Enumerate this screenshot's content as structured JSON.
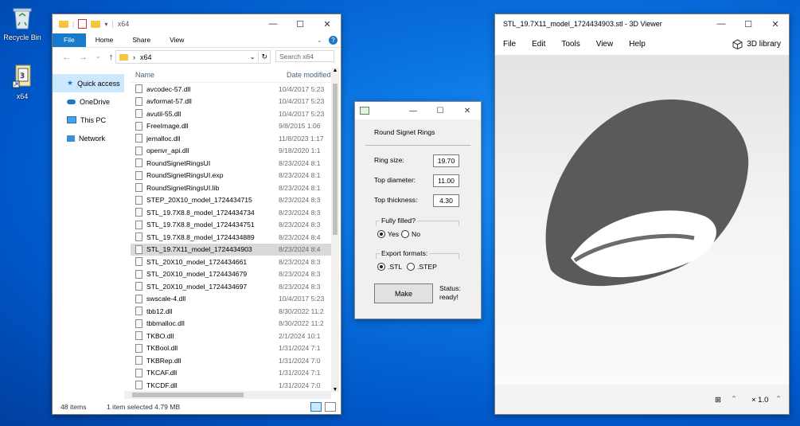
{
  "desktop": {
    "icons": [
      {
        "label": "Recycle Bin"
      },
      {
        "label": "x64"
      }
    ]
  },
  "explorer": {
    "title": "x64",
    "ribbon_tabs": [
      "File",
      "Home",
      "Share",
      "View"
    ],
    "address": {
      "path": "x64"
    },
    "search_placeholder": "Search x64",
    "nav_items": [
      "Quick access",
      "OneDrive",
      "This PC",
      "Network"
    ],
    "columns": {
      "name": "Name",
      "date": "Date modified"
    },
    "files": [
      {
        "name": "avcodec-57.dll",
        "date": "10/4/2017 5:23"
      },
      {
        "name": "avformat-57.dll",
        "date": "10/4/2017 5:23"
      },
      {
        "name": "avutil-55.dll",
        "date": "10/4/2017 5:23"
      },
      {
        "name": "FreeImage.dll",
        "date": "9/8/2015 1:06"
      },
      {
        "name": "jemalloc.dll",
        "date": "11/8/2023 1:17"
      },
      {
        "name": "openvr_api.dll",
        "date": "9/18/2020 1:1"
      },
      {
        "name": "RoundSignetRingsUI",
        "date": "8/23/2024 8:1"
      },
      {
        "name": "RoundSignetRingsUI.exp",
        "date": "8/23/2024 8:1"
      },
      {
        "name": "RoundSignetRingsUI.lib",
        "date": "8/23/2024 8:1"
      },
      {
        "name": "STEP_20X10_model_1724434715",
        "date": "8/23/2024 8:3"
      },
      {
        "name": "STL_19.7X8.8_model_1724434734",
        "date": "8/23/2024 8:3"
      },
      {
        "name": "STL_19.7X8.8_model_1724434751",
        "date": "8/23/2024 8:3"
      },
      {
        "name": "STL_19.7X8.8_model_1724434889",
        "date": "8/23/2024 8:4"
      },
      {
        "name": "STL_19.7X11_model_1724434903",
        "date": "8/23/2024 8:4"
      },
      {
        "name": "STL_20X10_model_1724434661",
        "date": "8/23/2024 8:3"
      },
      {
        "name": "STL_20X10_model_1724434679",
        "date": "8/23/2024 8:3"
      },
      {
        "name": "STL_20X10_model_1724434697",
        "date": "8/23/2024 8:3"
      },
      {
        "name": "swscale-4.dll",
        "date": "10/4/2017 5:23"
      },
      {
        "name": "tbb12.dll",
        "date": "8/30/2022 11:2"
      },
      {
        "name": "tbbmalloc.dll",
        "date": "8/30/2022 11:2"
      },
      {
        "name": "TKBO.dll",
        "date": "2/1/2024 10:1"
      },
      {
        "name": "TKBool.dll",
        "date": "1/31/2024 7:1"
      },
      {
        "name": "TKBRep.dll",
        "date": "1/31/2024 7:0"
      },
      {
        "name": "TKCAF.dll",
        "date": "1/31/2024 7:1"
      },
      {
        "name": "TKCDF.dll",
        "date": "1/31/2024 7:0"
      }
    ],
    "selected_index": 13,
    "status": {
      "count": "48 items",
      "selection": "1 item selected  4.79 MB"
    }
  },
  "dialog": {
    "heading": "Round Signet Rings",
    "ring_size_label": "Ring size:",
    "ring_size_value": "19.70",
    "top_diameter_label": "Top diameter:",
    "top_diameter_value": "11.00",
    "top_thickness_label": "Top thickness:",
    "top_thickness_value": "4.30",
    "fully_filled_label": "Fully filled?",
    "fully_filled_yes": "Yes",
    "fully_filled_no": "No",
    "export_label": "Export formats:",
    "export_stl": ".STL",
    "export_step": ".STEP",
    "make_button": "Make",
    "status_label": "Status:",
    "status_value": "ready!"
  },
  "viewer": {
    "title": "STL_19.7X11_model_1724434903.stl - 3D Viewer",
    "menu": [
      "File",
      "Edit",
      "Tools",
      "View",
      "Help"
    ],
    "library": "3D library",
    "zoom": "× 1.0",
    "model_color": "#5a5a5a"
  }
}
